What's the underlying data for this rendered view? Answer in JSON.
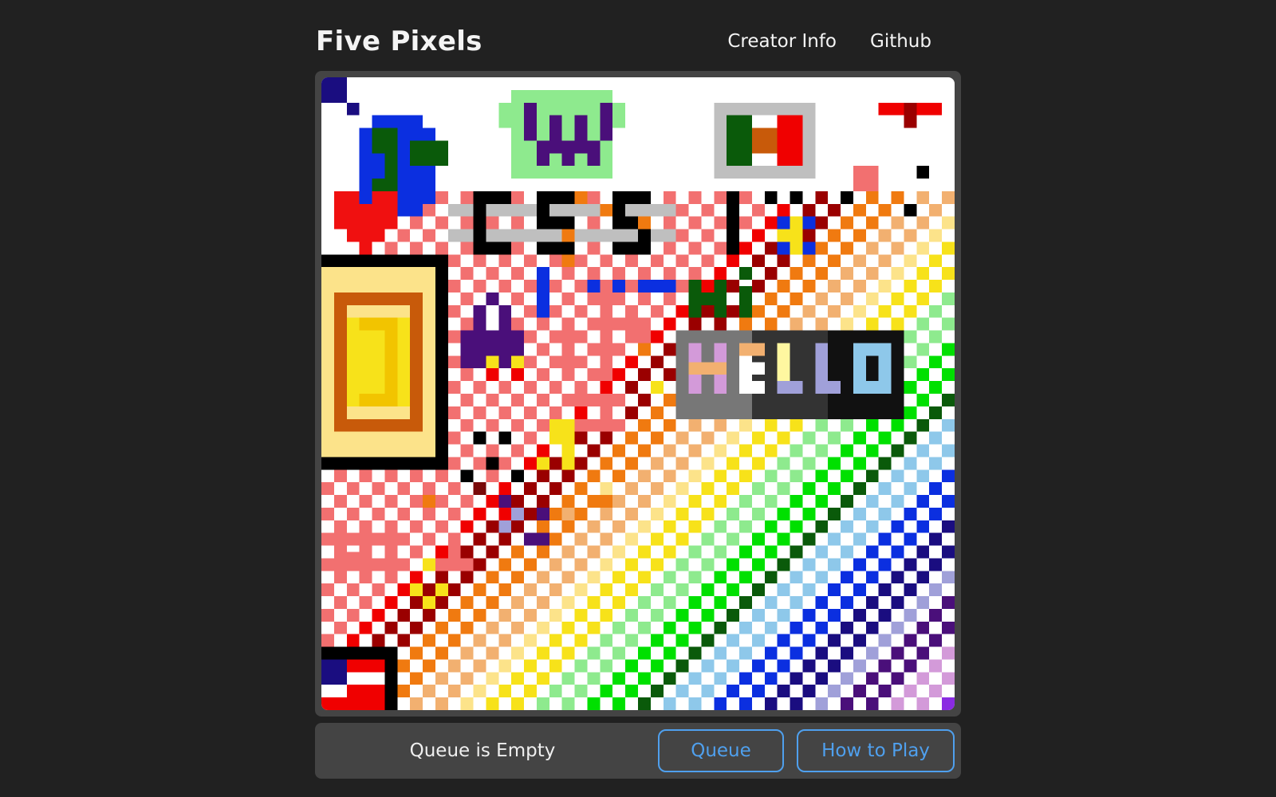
{
  "app": {
    "title": "Five Pixels"
  },
  "nav": {
    "creator_info": "Creator Info",
    "github": "Github"
  },
  "canvas": {
    "text_art": [
      "HELLO",
      "Hi",
      "HI"
    ]
  },
  "footer": {
    "queue_status": "Queue is Empty",
    "queue_button": "Queue",
    "how_to_play_button": "How to Play"
  },
  "colors": {
    "background": "#212121",
    "panel": "#444444",
    "accent": "#4fa0ee",
    "canvas_bg": "#ffffff"
  }
}
